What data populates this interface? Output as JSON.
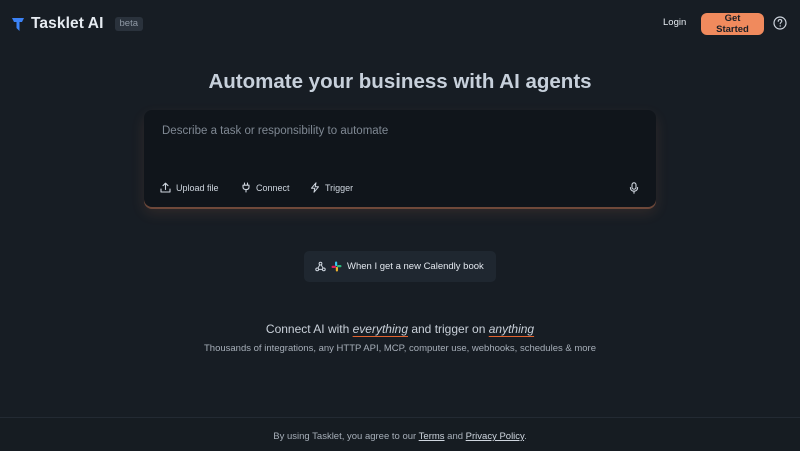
{
  "header": {
    "brand": "Tasklet AI",
    "badge": "beta",
    "login_label": "Login",
    "cta_label": "Get Started"
  },
  "hero": {
    "title": "Automate your business with AI agents",
    "input_placeholder": "Describe a task or responsibility to automate",
    "tools": {
      "upload": "Upload file",
      "connect": "Connect",
      "trigger": "Trigger"
    },
    "suggestion": "When I get a new Calendly book"
  },
  "tagline": {
    "part1": "Connect AI with ",
    "em1": "everything",
    "part2": " and trigger on ",
    "em2": "anything",
    "subline": "Thousands of integrations, any HTTP API, MCP, computer use, webhooks, schedules & more"
  },
  "footer": {
    "prefix": "By using Tasklet, you agree to our ",
    "terms": "Terms",
    "and": " and ",
    "privacy": "Privacy Policy",
    "suffix": "."
  },
  "colors": {
    "background": "#171d24",
    "accent": "#f08a5d",
    "underline": "#e2632f",
    "logo": "#3b82f6"
  },
  "icons": [
    "tasklet-logo-icon",
    "help-circle-icon",
    "upload-icon",
    "plug-icon",
    "lightning-icon",
    "microphone-icon",
    "webhook-icon",
    "slack-icon"
  ]
}
